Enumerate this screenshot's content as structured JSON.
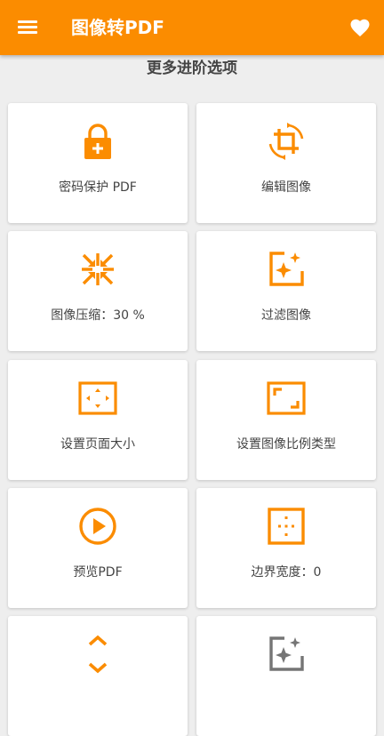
{
  "header": {
    "title": "图像转PDF",
    "menu_icon": "menu-icon",
    "favorite_icon": "heart-icon"
  },
  "section_title": "更多进阶选项",
  "colors": {
    "accent": "#fb8c00",
    "background": "#eeeeee",
    "card": "#ffffff"
  },
  "cards": [
    {
      "label": "密码保护 PDF",
      "icon": "lock-plus-icon"
    },
    {
      "label": "编辑图像",
      "icon": "crop-rotate-icon"
    },
    {
      "label": "图像压缩：30 %",
      "icon": "compress-icon"
    },
    {
      "label": "过滤图像",
      "icon": "image-filter-icon"
    },
    {
      "label": "设置页面大小",
      "icon": "page-size-icon"
    },
    {
      "label": "设置图像比例类型",
      "icon": "aspect-ratio-icon"
    },
    {
      "label": "预览PDF",
      "icon": "play-circle-icon"
    },
    {
      "label": "边界宽度：0",
      "icon": "border-width-icon"
    },
    {
      "label": "",
      "icon": "reorder-icon"
    },
    {
      "label": "",
      "icon": "grayscale-filter-icon"
    }
  ]
}
